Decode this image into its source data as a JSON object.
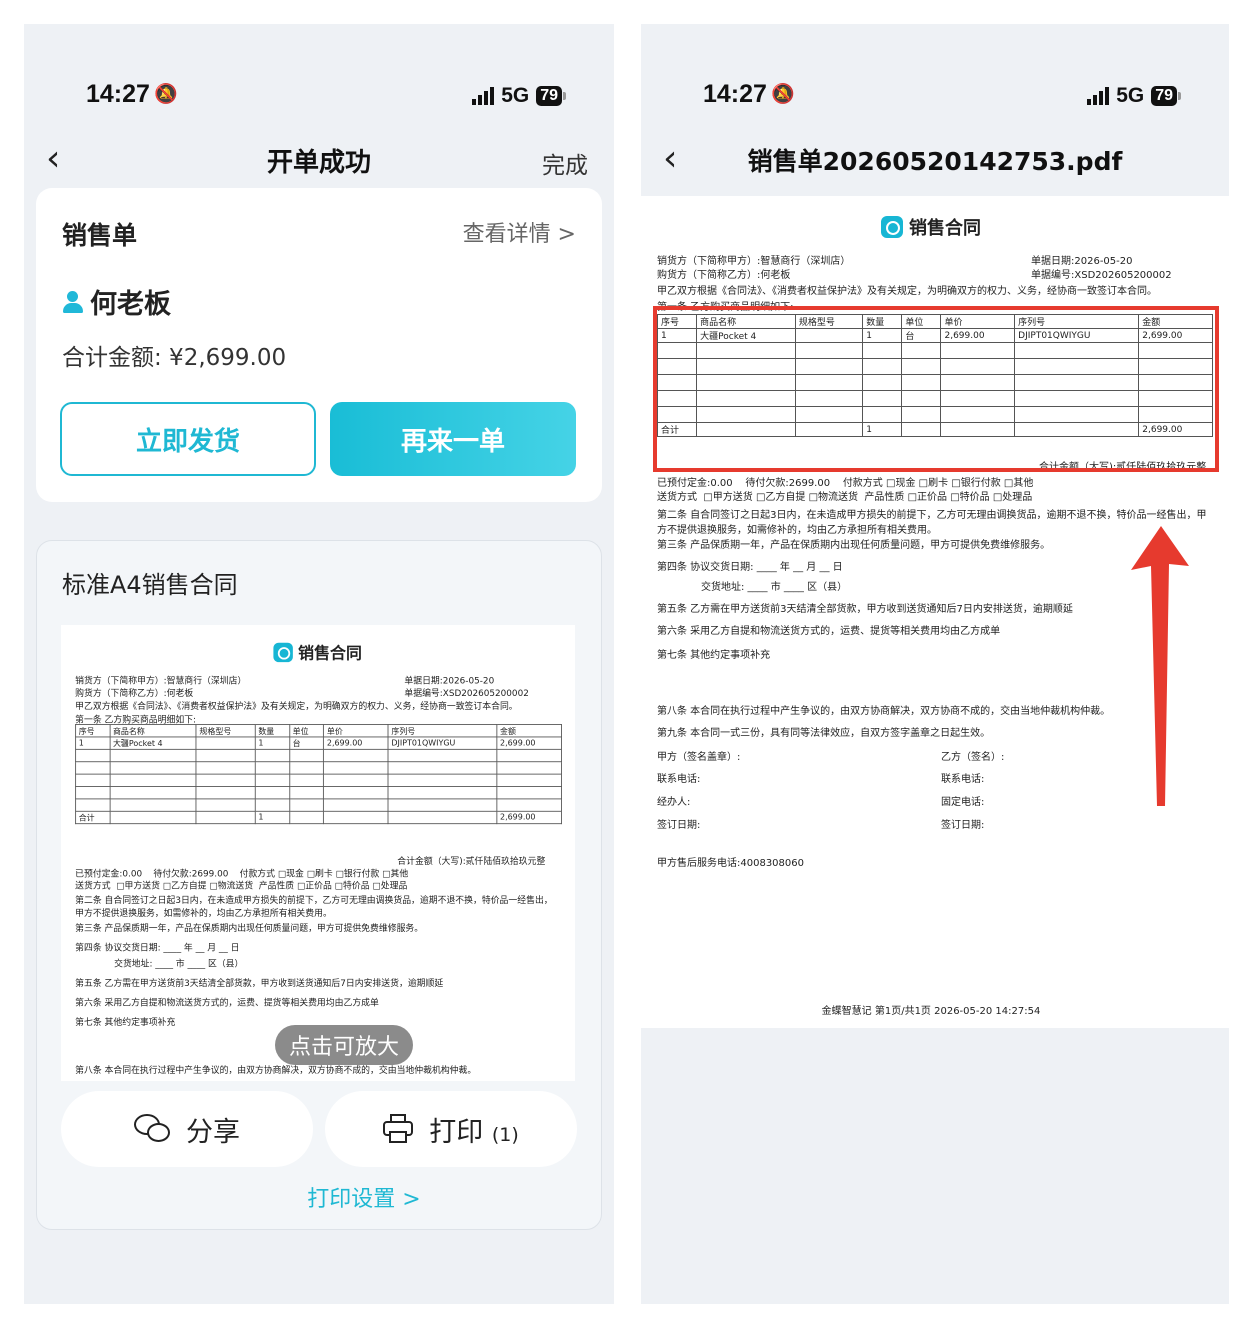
{
  "left": {
    "status": {
      "time": "14:27",
      "network": "5G",
      "battery": "79"
    },
    "nav": {
      "title": "开单成功",
      "done": "完成"
    },
    "order": {
      "title": "销售单",
      "detail_link": "查看详情 >",
      "customer": "何老板",
      "total": "合计金额: ¥2,699.00",
      "ship_button": "立即发货",
      "again_button": "再来一单"
    },
    "template": {
      "title": "标准A4销售合同",
      "zoom_hint": "点击可放大",
      "share": "分享",
      "print": "打印",
      "print_count": "(1)",
      "print_settings": "打印设置 >"
    }
  },
  "right": {
    "status": {
      "time": "14:27",
      "network": "5G",
      "battery": "79"
    },
    "nav": {
      "title": "销售单20260520142753.pdf"
    }
  },
  "contract": {
    "title": "销售合同",
    "seller": "销货方（下简称甲方）:智慧商行（深圳店）",
    "buyer": "购货方（下简称乙方）:何老板",
    "date": "单据日期:2026-05-20",
    "number": "单据编号:XSD202605200002",
    "intro": "甲乙双方根据《合同法》、《消费者权益保护法》及有关规定，为明确双方的权力、义务，经协商一致签订本合同。",
    "clause1": "第一条 乙方购买商品明细如下:",
    "headers": [
      "序号",
      "商品名称",
      "规格型号",
      "数量",
      "单位",
      "单价",
      "序列号",
      "金额"
    ],
    "row": [
      "1",
      "大疆Pocket 4",
      "",
      "1",
      "台",
      "2,699.00",
      "DJIPT01QWIYGU",
      "2,699.00"
    ],
    "sum_label": "合计",
    "sum_qty": "1",
    "sum_amount": "2,699.00",
    "sum_words": "合计金额（大写):贰仟陆佰玖拾玖元整",
    "prepaid": "已预付定金:0.00",
    "owed": "待付欠款:2699.00",
    "pay_method": "付款方式",
    "pay_options": "□现金 □刷卡 □银行付款 □其他",
    "delivery": "送货方式",
    "delivery_options": "□甲方送货 □乙方自提 □物流送货",
    "product_nature": "产品性质",
    "nature_options": "□正价品 □特价品 □处理品",
    "c2": "第二条 自合同签订之日起3日内，在未造成甲方损失的前提下，乙方可无理由调换货品，逾期不退不换，特价品一经售出，甲方不提供退换服务，如需修补的，均由乙方承担所有相关费用。",
    "c3": "第三条 产品保质期一年，产品在保质期内出现任何质量问题，甲方可提供免费维修服务。",
    "c4": "第四条 协议交货日期: ____ 年 __ 月 __ 日",
    "c4b": "交货地址: ____ 市 ____ 区（县）",
    "c5": "第五条 乙方需在甲方送货前3天结清全部货款，甲方收到送货通知后7日内安排送货，逾期顺延",
    "c6": "第六条 采用乙方自提和物流送货方式的，运费、提货等相关费用均由乙方成单",
    "c7": "第七条 其他约定事项补充",
    "c8": "第八条 本合同在执行过程中产生争议的，由双方协商解决，双方协商不成的，交由当地仲裁机构仲裁。",
    "c9": "第九条 本合同一式三份，具有同等法律效应，自双方签字盖章之日起生效。",
    "sign_a": "甲方（签名盖章）:",
    "sign_b": "乙方（签名）:",
    "phone_a": "联系电话:",
    "phone_b": "联系电话:",
    "handler": "经办人:",
    "fixed_phone": "固定电话:",
    "sign_date_a": "签订日期:",
    "sign_date_b": "签订日期:",
    "service": "甲方售后服务电话:4008308060",
    "footer": "金蝶智慧记  第1页/共1页  2026-05-20 14:27:54"
  },
  "colors": {
    "accent": "#1fb8d3",
    "highlight": "#e63a2e"
  }
}
